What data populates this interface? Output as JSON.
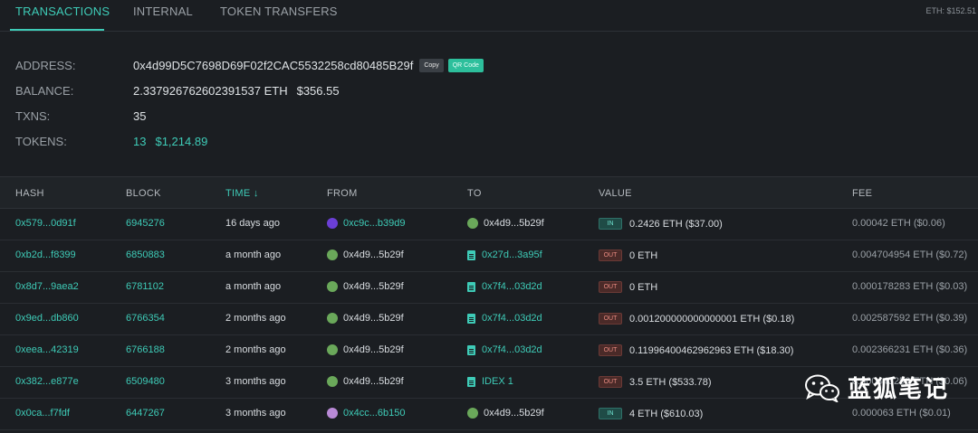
{
  "tabs": [
    {
      "label": "TRANSACTIONS",
      "active": true
    },
    {
      "label": "INTERNAL",
      "active": false
    },
    {
      "label": "TOKEN TRANSFERS",
      "active": false
    }
  ],
  "eth_price": "ETH: $152.51",
  "summary": {
    "address_label": "ADDRESS:",
    "address": "0x4d99D5C7698D69F02f2CAC5532258cd80485B29f",
    "copy_label": "Copy",
    "qr_label": "QR Code",
    "balance_label": "BALANCE:",
    "balance_eth": "2.337926762602391537 ETH",
    "balance_usd": "$356.55",
    "txns_label": "TXNS:",
    "txns": "35",
    "tokens_label": "TOKENS:",
    "tokens_count": "13",
    "tokens_usd": "$1,214.89"
  },
  "table": {
    "headers": {
      "hash": "HASH",
      "block": "BLOCK",
      "time": "TIME ↓",
      "from": "FROM",
      "to": "TO",
      "value": "VALUE",
      "fee": "FEE"
    },
    "rows": [
      {
        "hash": "0x579...0d91f",
        "block": "6945276",
        "time": "16 days ago",
        "from": "0xc9c...b39d9",
        "from_icon": "purple-avatar",
        "to": "0x4d9...5b29f",
        "to_icon": "green-avatar",
        "dir": "IN",
        "value": "0.2426 ETH ($37.00)",
        "fee": "0.00042 ETH ($0.06)"
      },
      {
        "hash": "0xb2d...f8399",
        "block": "6850883",
        "time": "a month ago",
        "from": "0x4d9...5b29f",
        "from_icon": "green-avatar",
        "to": "0x27d...3a95f",
        "to_icon": "contract-icon",
        "dir": "OUT",
        "value": "0 ETH",
        "fee": "0.004704954 ETH ($0.72)"
      },
      {
        "hash": "0x8d7...9aea2",
        "block": "6781102",
        "time": "a month ago",
        "from": "0x4d9...5b29f",
        "from_icon": "green-avatar",
        "to": "0x7f4...03d2d",
        "to_icon": "contract-icon",
        "dir": "OUT",
        "value": "0 ETH",
        "fee": "0.000178283 ETH ($0.03)"
      },
      {
        "hash": "0x9ed...db860",
        "block": "6766354",
        "time": "2 months ago",
        "from": "0x4d9...5b29f",
        "from_icon": "green-avatar",
        "to": "0x7f4...03d2d",
        "to_icon": "contract-icon",
        "dir": "OUT",
        "value": "0.001200000000000001 ETH ($0.18)",
        "fee": "0.002587592 ETH ($0.39)"
      },
      {
        "hash": "0xeea...42319",
        "block": "6766188",
        "time": "2 months ago",
        "from": "0x4d9...5b29f",
        "from_icon": "green-avatar",
        "to": "0x7f4...03d2d",
        "to_icon": "contract-icon",
        "dir": "OUT",
        "value": "0.11996400462962963 ETH ($18.30)",
        "fee": "0.002366231 ETH ($0.36)"
      },
      {
        "hash": "0x382...e877e",
        "block": "6509480",
        "time": "3 months ago",
        "from": "0x4d9...5b29f",
        "from_icon": "green-avatar",
        "to": "IDEX 1",
        "to_icon": "contract-icon",
        "dir": "OUT",
        "value": "3.5 ETH ($533.78)",
        "fee": "0.000443256 ETH ($0.06)"
      },
      {
        "hash": "0x0ca...f7fdf",
        "block": "6447267",
        "time": "3 months ago",
        "from": "0x4cc...6b150",
        "from_icon": "pink-avatar",
        "to": "0x4d9...5b29f",
        "to_icon": "green-avatar",
        "dir": "IN",
        "value": "4 ETH ($610.03)",
        "fee": "0.000063 ETH ($0.01)"
      }
    ]
  },
  "colors": {
    "accent": "#3ecbb7",
    "in_badge": "#1f4b46",
    "out_badge": "#4a2a28",
    "purple-avatar": "#6b3fd6",
    "green-avatar": "#6aa85a",
    "pink-avatar": "#b98ad6"
  },
  "watermark": {
    "text": "蓝狐笔记"
  }
}
